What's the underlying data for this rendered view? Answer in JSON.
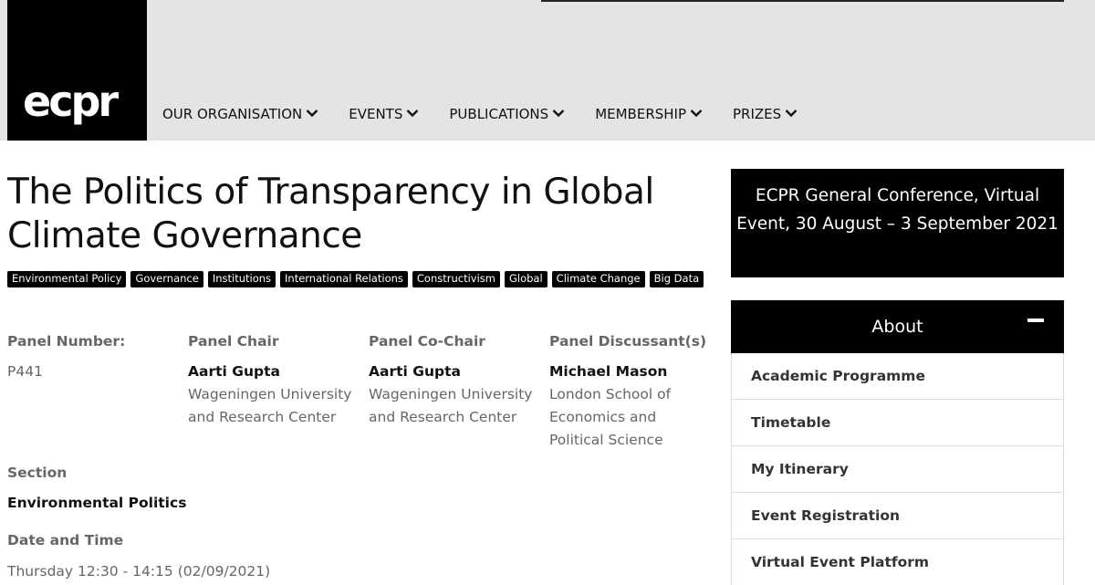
{
  "header": {
    "logo_text": "ecpr",
    "nav": [
      {
        "label": "OUR ORGANISATION"
      },
      {
        "label": "EVENTS"
      },
      {
        "label": "PUBLICATIONS"
      },
      {
        "label": "MEMBERSHIP"
      },
      {
        "label": "PRIZES"
      }
    ]
  },
  "panel": {
    "title": "The Politics of Transparency in Global Climate Governance",
    "tags": [
      "Environmental Policy",
      "Governance",
      "Institutions",
      "International Relations",
      "Constructivism",
      "Global",
      "Climate Change",
      "Big Data"
    ],
    "number_label": "Panel Number:",
    "number": "P441",
    "chair_label": "Panel Chair",
    "chair_name": "Aarti Gupta",
    "chair_affil": "Wageningen University and Research Center",
    "cochair_label": "Panel Co-Chair",
    "cochair_name": "Aarti Gupta",
    "cochair_affil": "Wageningen University and Research Center",
    "discussant_label": "Panel Discussant(s)",
    "discussant_name": "Michael Mason",
    "discussant_affil": "London School of Economics and Political Science",
    "section_label": "Section",
    "section_value": "Environmental Politics",
    "datetime_label": "Date and Time",
    "datetime_value": "Thursday 12:30 - 14:15 (02/09/2021)"
  },
  "sidebar": {
    "event": "ECPR General Conference, Virtual Event, 30 August – 3 September 2021",
    "about_label": "About",
    "menu": [
      {
        "label": "Academic Programme"
      },
      {
        "label": "Timetable"
      },
      {
        "label": "My Itinerary"
      },
      {
        "label": "Event Registration"
      },
      {
        "label": "Virtual Event Platform"
      }
    ]
  }
}
